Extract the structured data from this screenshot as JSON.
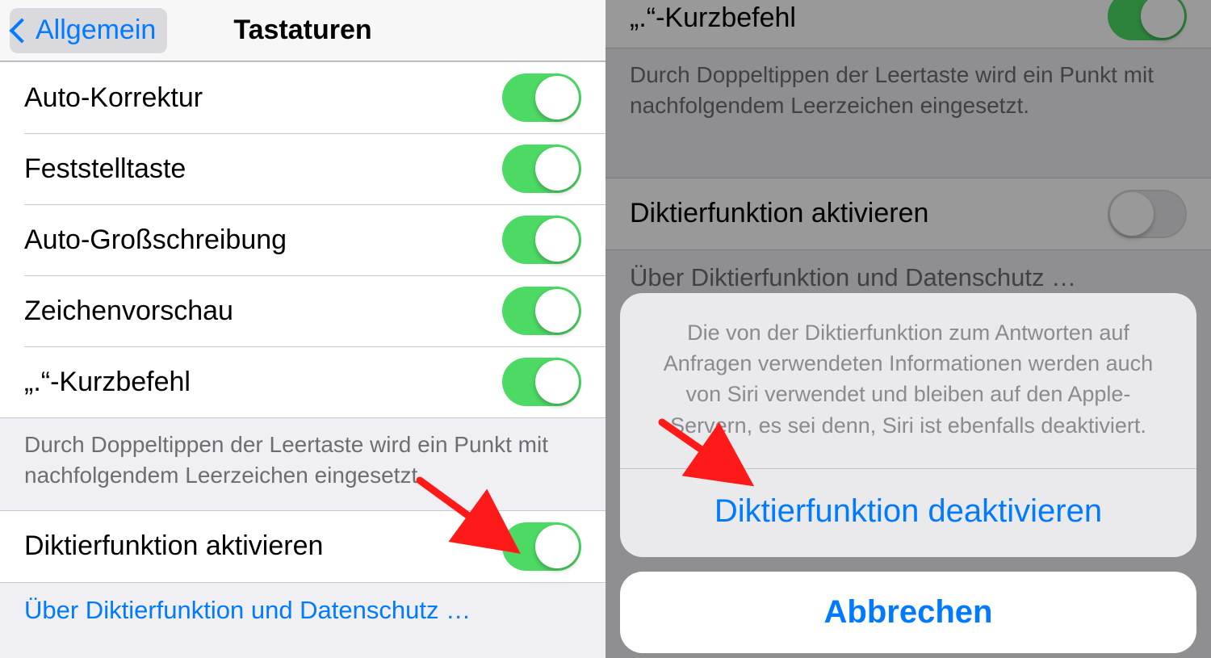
{
  "left": {
    "back_label": "Allgemein",
    "title": "Tastaturen",
    "rows": [
      {
        "label": "Auto-Korrektur",
        "on": true
      },
      {
        "label": "Feststelltaste",
        "on": true
      },
      {
        "label": "Auto-Großschreibung",
        "on": true
      },
      {
        "label": "Zeichenvorschau",
        "on": true
      },
      {
        "label": "„.“-Kurzbefehl",
        "on": true
      }
    ],
    "shortcut_footer": "Durch Doppeltippen der Leertaste wird ein Punkt mit nachfolgendem Leerzeichen eingesetzt.",
    "dictation_row": {
      "label": "Diktierfunktion aktivieren",
      "on": true
    },
    "dictation_link": "Über Diktierfunktion und Datenschutz …"
  },
  "right": {
    "partial_row": {
      "label": "„.“-Kurzbefehl",
      "on": true
    },
    "shortcut_footer": "Durch Doppeltippen der Leertaste wird ein Punkt mit nachfolgendem Leerzeichen eingesetzt.",
    "dictation_row": {
      "label": "Diktierfunktion aktivieren",
      "on": false
    },
    "dictation_link": "Über Diktierfunktion und Datenschutz …",
    "sheet": {
      "message": "Die von der Diktierfunktion zum Antworten auf Anfragen verwendeten Informationen werden auch von Siri verwendet und bleiben auf den Apple-Servern, es sei denn, Siri ist ebenfalls deaktiviert.",
      "confirm": "Diktierfunktion deaktivieren",
      "cancel": "Abbrechen"
    }
  }
}
